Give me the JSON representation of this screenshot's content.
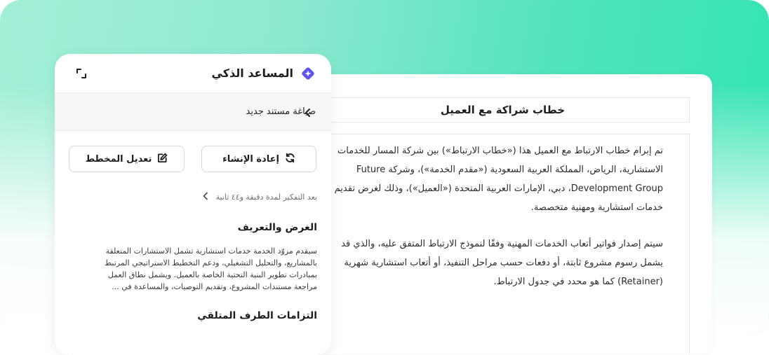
{
  "assistant": {
    "title": "المساعد الذكي",
    "subheader": "صياغة مستند جديد",
    "regenerate_label": "إعادة الإنشاء",
    "edit_plan_label": "تعديل المخطط",
    "thinking_text": "بعد التفكير لمدة دقيقة و٤٤ ثانية",
    "section1_title": "الغرض والتعريف",
    "section1_lines": [
      "سيقدم مزوّد الخدمة خدمات استشارية تشمل الاستشارات المتعلقة",
      "بالمشاريع، والتحليل التشغيلي، ودعم التخطيط الاستراتيجي المرتبط",
      "بمبادرات تطوير البنية التحتية الخاصة بالعميل. ويشمل نطاق العمل",
      "مراجعة مستندات المشروع، وتقديم التوصيات، والمساعدة في ..."
    ],
    "section2_title": "التزامات الطرف المتلقي"
  },
  "document": {
    "title": "خطاب شراكة مع العميل",
    "paragraph1": [
      "تم إبرام خطاب الارتباط مع العميل هذا («خطاب الارتباط») بين شركة المسار للخدمات",
      "الاستشارية، الرياض، المملكة العربية السعودية («مقدم الخدمة»)، وشركة Future",
      "Development Group، دبي، الإمارات العربية المتحدة («العميل»)، وذلك لغرض تقديم",
      "خدمات استشارية ومهنية متخصصة."
    ],
    "paragraph2": [
      "سيتم إصدار فواتير أتعاب الخدمات المهنية وفقًا لنموذج الارتباط المتفق عليه، والذي قد",
      "يشمل رسوم مشروع ثابتة، أو دفعات حسب مراحل التنفيذ، أو أتعاب استشارية شهرية",
      "(Retainer) كما هو محدد في جدول الارتباط."
    ]
  },
  "colors": {
    "accent": "#5b52f0",
    "gradient_start": "#a3efd8",
    "gradient_end": "#31e4b1"
  },
  "icons": {
    "logo": "sparkle-icon",
    "expand": "expand-icon",
    "back": "chevron-left-icon",
    "regenerate": "refresh-icon",
    "edit": "edit-icon",
    "thinking": "chevron-left-icon"
  }
}
